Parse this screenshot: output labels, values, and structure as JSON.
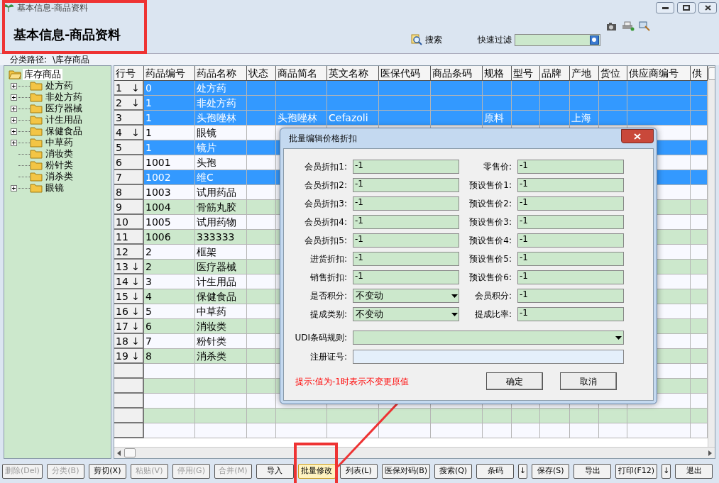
{
  "window": {
    "title": "基本信息-商品资料"
  },
  "heading": "基本信息-商品资料",
  "search": {
    "label": "搜索"
  },
  "filter": {
    "label": "快速过滤"
  },
  "path": {
    "label": "分类路径:",
    "value": "\\库存商品"
  },
  "tree": {
    "label": "库存商品",
    "selected": true,
    "expanded": true,
    "children": [
      {
        "label": "处方药",
        "expandable": true
      },
      {
        "label": "非处方药",
        "expandable": true
      },
      {
        "label": "医疗器械",
        "expandable": true
      },
      {
        "label": "计生用品",
        "expandable": true
      },
      {
        "label": "保健食品",
        "expandable": true
      },
      {
        "label": "中草药",
        "expandable": true
      },
      {
        "label": "消妆类",
        "expandable": false
      },
      {
        "label": "粉针类",
        "expandable": false
      },
      {
        "label": "消杀类",
        "expandable": false
      },
      {
        "label": "眼镜",
        "expandable": true
      }
    ]
  },
  "table": {
    "columns": [
      {
        "label": "行号"
      },
      {
        "label": "药品编号"
      },
      {
        "label": "药品名称"
      },
      {
        "label": "状态"
      },
      {
        "label": "商品简名"
      },
      {
        "label": "英文名称"
      },
      {
        "label": "医保代码"
      },
      {
        "label": "商品条码"
      },
      {
        "label": "规格"
      },
      {
        "label": "型号"
      },
      {
        "label": "品牌"
      },
      {
        "label": "产地"
      },
      {
        "label": "货位"
      },
      {
        "label": "供应商编号"
      },
      {
        "label": "供"
      }
    ],
    "rows": [
      {
        "no": "1",
        "arrow": "↓",
        "code": "0",
        "name": "处方药",
        "selected": true
      },
      {
        "no": "2",
        "arrow": "↓",
        "code": "1",
        "name": "非处方药",
        "selected": true
      },
      {
        "no": "3",
        "code": "1",
        "name": "头孢唑林",
        "short_name": "头孢唑林",
        "english_name": "Cefazoli",
        "spec": "原料",
        "origin": "上海",
        "selected": true
      },
      {
        "no": "4",
        "arrow": "↓",
        "code": "1",
        "name": "眼镜",
        "selected": false
      },
      {
        "no": "5",
        "code": "1",
        "name": "镜片",
        "selected": true
      },
      {
        "no": "6",
        "code": "1001",
        "name": "头孢",
        "selected": false
      },
      {
        "no": "7",
        "code": "1002",
        "name": "维C",
        "selected": true
      },
      {
        "no": "8",
        "code": "1003",
        "name": "试用药品",
        "selected": false
      },
      {
        "no": "9",
        "code": "1004",
        "name": "骨筋丸胶",
        "selected": false
      },
      {
        "no": "10",
        "code": "1005",
        "name": "试用药物",
        "selected": false
      },
      {
        "no": "11",
        "code": "1006",
        "name": "333333",
        "selected": false
      },
      {
        "no": "12",
        "code": "2",
        "name": "框架",
        "selected": false
      },
      {
        "no": "13",
        "arrow": "↓",
        "code": "2",
        "name": "医疗器械",
        "selected": false
      },
      {
        "no": "14",
        "arrow": "↓",
        "code": "3",
        "name": "计生用品",
        "selected": false
      },
      {
        "no": "15",
        "arrow": "↓",
        "code": "4",
        "name": "保健食品",
        "selected": false
      },
      {
        "no": "16",
        "arrow": "↓",
        "code": "5",
        "name": "中草药",
        "selected": false
      },
      {
        "no": "17",
        "arrow": "↓",
        "code": "6",
        "name": "消妆类",
        "selected": false
      },
      {
        "no": "18",
        "arrow": "↓",
        "code": "7",
        "name": "粉针类",
        "selected": false
      },
      {
        "no": "19",
        "arrow": "↓",
        "code": "8",
        "name": "消杀类",
        "selected": false
      }
    ]
  },
  "dialog": {
    "title": "批量编辑价格折扣",
    "left": [
      {
        "label": "会员折扣1:",
        "value": "-1",
        "kind": "field"
      },
      {
        "label": "会员折扣2:",
        "value": "-1",
        "kind": "field"
      },
      {
        "label": "会员折扣3:",
        "value": "-1",
        "kind": "field"
      },
      {
        "label": "会员折扣4:",
        "value": "-1",
        "kind": "field"
      },
      {
        "label": "会员折扣5:",
        "value": "-1",
        "kind": "field"
      },
      {
        "label": "进货折扣:",
        "value": "-1",
        "kind": "field"
      },
      {
        "label": "销售折扣:",
        "value": "-1",
        "kind": "field"
      },
      {
        "label": "是否积分:",
        "value": "不变动",
        "kind": "select"
      },
      {
        "label": "提成类别:",
        "value": "不变动",
        "kind": "select"
      }
    ],
    "right": [
      {
        "label": "零售价:",
        "value": "-1",
        "kind": "field"
      },
      {
        "label": "预设售价1:",
        "value": "-1",
        "kind": "field"
      },
      {
        "label": "预设售价2:",
        "value": "-1",
        "kind": "field"
      },
      {
        "label": "预设售价3:",
        "value": "-1",
        "kind": "field"
      },
      {
        "label": "预设售价4:",
        "value": "-1",
        "kind": "field"
      },
      {
        "label": "预设售价5:",
        "value": "-1",
        "kind": "field"
      },
      {
        "label": "预设售价6:",
        "value": "-1",
        "kind": "field"
      },
      {
        "label": "会员积分:",
        "value": "-1",
        "kind": "field"
      },
      {
        "label": "提成比率:",
        "value": "-1",
        "kind": "field"
      }
    ],
    "udi": {
      "label": "UDI条码规则:"
    },
    "registration": {
      "label": "注册证号:"
    },
    "hint": "提示:值为-1时表示不变更原值",
    "buttons": [
      "确定",
      "取消"
    ]
  },
  "bottom_buttons": [
    {
      "label": "删除(Del)",
      "disabled": true,
      "selected": false
    },
    {
      "label": "分类(B)",
      "disabled": true,
      "selected": false
    },
    {
      "label": "剪切(X)",
      "disabled": false,
      "selected": false
    },
    {
      "label": "粘贴(V)",
      "disabled": true,
      "selected": false
    },
    {
      "label": "停用(G)",
      "disabled": true,
      "selected": false
    },
    {
      "label": "合并(M)",
      "disabled": true,
      "selected": false
    },
    {
      "label": "导入",
      "disabled": false,
      "selected": false
    },
    {
      "label": "批量修改",
      "disabled": false,
      "selected": true
    },
    {
      "label": "列表(L)",
      "disabled": false,
      "selected": false
    },
    {
      "label": "医保对码(B)",
      "disabled": false,
      "selected": false
    },
    {
      "label": "搜索(Q)",
      "disabled": false,
      "selected": false
    },
    {
      "label": "条码",
      "disabled": false,
      "selected": false
    },
    {
      "label": "↓",
      "disabled": false,
      "selected": false,
      "kind": "small"
    },
    {
      "label": "保存(S)",
      "disabled": false,
      "selected": false
    },
    {
      "label": "导出",
      "disabled": false,
      "selected": false
    },
    {
      "label": "打印(F12)",
      "disabled": false,
      "selected": false
    },
    {
      "label": "↓",
      "disabled": false,
      "selected": false,
      "kind": "small"
    },
    {
      "label": "退出",
      "disabled": false,
      "selected": false
    }
  ]
}
